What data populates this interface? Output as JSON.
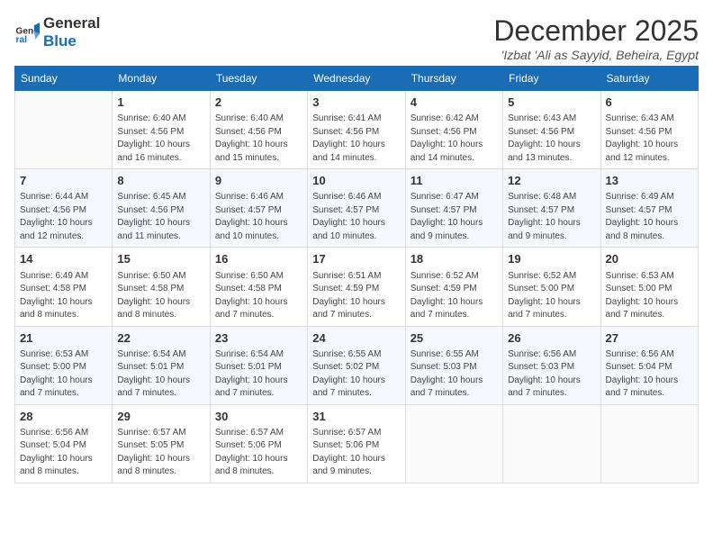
{
  "logo": {
    "general": "General",
    "blue": "Blue"
  },
  "title": {
    "month": "December 2025",
    "subtitle": "'Izbat 'Ali as Sayyid, Beheira, Egypt"
  },
  "headers": [
    "Sunday",
    "Monday",
    "Tuesday",
    "Wednesday",
    "Thursday",
    "Friday",
    "Saturday"
  ],
  "weeks": [
    [
      {
        "day": "",
        "info": ""
      },
      {
        "day": "1",
        "info": "Sunrise: 6:40 AM\nSunset: 4:56 PM\nDaylight: 10 hours\nand 16 minutes."
      },
      {
        "day": "2",
        "info": "Sunrise: 6:40 AM\nSunset: 4:56 PM\nDaylight: 10 hours\nand 15 minutes."
      },
      {
        "day": "3",
        "info": "Sunrise: 6:41 AM\nSunset: 4:56 PM\nDaylight: 10 hours\nand 14 minutes."
      },
      {
        "day": "4",
        "info": "Sunrise: 6:42 AM\nSunset: 4:56 PM\nDaylight: 10 hours\nand 14 minutes."
      },
      {
        "day": "5",
        "info": "Sunrise: 6:43 AM\nSunset: 4:56 PM\nDaylight: 10 hours\nand 13 minutes."
      },
      {
        "day": "6",
        "info": "Sunrise: 6:43 AM\nSunset: 4:56 PM\nDaylight: 10 hours\nand 12 minutes."
      }
    ],
    [
      {
        "day": "7",
        "info": "Sunrise: 6:44 AM\nSunset: 4:56 PM\nDaylight: 10 hours\nand 12 minutes."
      },
      {
        "day": "8",
        "info": "Sunrise: 6:45 AM\nSunset: 4:56 PM\nDaylight: 10 hours\nand 11 minutes."
      },
      {
        "day": "9",
        "info": "Sunrise: 6:46 AM\nSunset: 4:57 PM\nDaylight: 10 hours\nand 10 minutes."
      },
      {
        "day": "10",
        "info": "Sunrise: 6:46 AM\nSunset: 4:57 PM\nDaylight: 10 hours\nand 10 minutes."
      },
      {
        "day": "11",
        "info": "Sunrise: 6:47 AM\nSunset: 4:57 PM\nDaylight: 10 hours\nand 9 minutes."
      },
      {
        "day": "12",
        "info": "Sunrise: 6:48 AM\nSunset: 4:57 PM\nDaylight: 10 hours\nand 9 minutes."
      },
      {
        "day": "13",
        "info": "Sunrise: 6:49 AM\nSunset: 4:57 PM\nDaylight: 10 hours\nand 8 minutes."
      }
    ],
    [
      {
        "day": "14",
        "info": "Sunrise: 6:49 AM\nSunset: 4:58 PM\nDaylight: 10 hours\nand 8 minutes."
      },
      {
        "day": "15",
        "info": "Sunrise: 6:50 AM\nSunset: 4:58 PM\nDaylight: 10 hours\nand 8 minutes."
      },
      {
        "day": "16",
        "info": "Sunrise: 6:50 AM\nSunset: 4:58 PM\nDaylight: 10 hours\nand 7 minutes."
      },
      {
        "day": "17",
        "info": "Sunrise: 6:51 AM\nSunset: 4:59 PM\nDaylight: 10 hours\nand 7 minutes."
      },
      {
        "day": "18",
        "info": "Sunrise: 6:52 AM\nSunset: 4:59 PM\nDaylight: 10 hours\nand 7 minutes."
      },
      {
        "day": "19",
        "info": "Sunrise: 6:52 AM\nSunset: 5:00 PM\nDaylight: 10 hours\nand 7 minutes."
      },
      {
        "day": "20",
        "info": "Sunrise: 6:53 AM\nSunset: 5:00 PM\nDaylight: 10 hours\nand 7 minutes."
      }
    ],
    [
      {
        "day": "21",
        "info": "Sunrise: 6:53 AM\nSunset: 5:00 PM\nDaylight: 10 hours\nand 7 minutes."
      },
      {
        "day": "22",
        "info": "Sunrise: 6:54 AM\nSunset: 5:01 PM\nDaylight: 10 hours\nand 7 minutes."
      },
      {
        "day": "23",
        "info": "Sunrise: 6:54 AM\nSunset: 5:01 PM\nDaylight: 10 hours\nand 7 minutes."
      },
      {
        "day": "24",
        "info": "Sunrise: 6:55 AM\nSunset: 5:02 PM\nDaylight: 10 hours\nand 7 minutes."
      },
      {
        "day": "25",
        "info": "Sunrise: 6:55 AM\nSunset: 5:03 PM\nDaylight: 10 hours\nand 7 minutes."
      },
      {
        "day": "26",
        "info": "Sunrise: 6:56 AM\nSunset: 5:03 PM\nDaylight: 10 hours\nand 7 minutes."
      },
      {
        "day": "27",
        "info": "Sunrise: 6:56 AM\nSunset: 5:04 PM\nDaylight: 10 hours\nand 7 minutes."
      }
    ],
    [
      {
        "day": "28",
        "info": "Sunrise: 6:56 AM\nSunset: 5:04 PM\nDaylight: 10 hours\nand 8 minutes."
      },
      {
        "day": "29",
        "info": "Sunrise: 6:57 AM\nSunset: 5:05 PM\nDaylight: 10 hours\nand 8 minutes."
      },
      {
        "day": "30",
        "info": "Sunrise: 6:57 AM\nSunset: 5:06 PM\nDaylight: 10 hours\nand 8 minutes."
      },
      {
        "day": "31",
        "info": "Sunrise: 6:57 AM\nSunset: 5:06 PM\nDaylight: 10 hours\nand 9 minutes."
      },
      {
        "day": "",
        "info": ""
      },
      {
        "day": "",
        "info": ""
      },
      {
        "day": "",
        "info": ""
      }
    ]
  ]
}
